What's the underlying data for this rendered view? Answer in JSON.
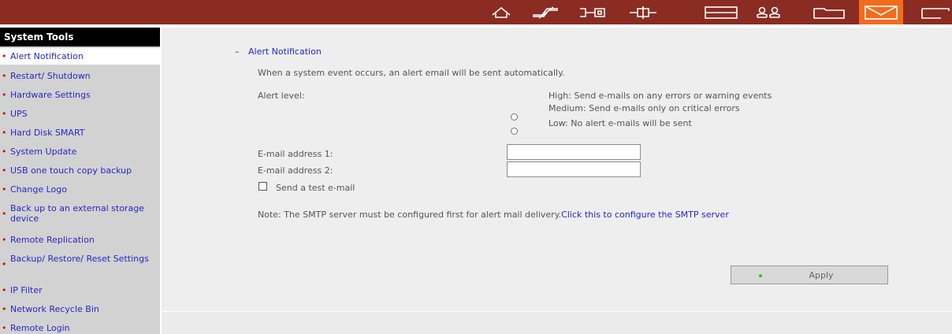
{
  "toolbar": {
    "icons": [
      {
        "name": "home-icon"
      },
      {
        "name": "network-icon"
      },
      {
        "name": "device-icon"
      },
      {
        "name": "connection-icon"
      },
      {
        "name": "disk-icon"
      },
      {
        "name": "users-icon"
      },
      {
        "name": "folder-icon"
      },
      {
        "name": "mail-icon",
        "active": true
      },
      {
        "name": "tools-icon"
      }
    ],
    "bar_color": "#8a2c22",
    "active_color": "#f26c1e"
  },
  "sidebar": {
    "header": "System Tools",
    "items": [
      {
        "label": "Alert Notification",
        "selected": true
      },
      {
        "label": "Restart/ Shutdown"
      },
      {
        "label": "Hardware Settings"
      },
      {
        "label": "UPS"
      },
      {
        "label": "Hard Disk SMART"
      },
      {
        "label": "System Update"
      },
      {
        "label": "USB one touch copy backup"
      },
      {
        "label": "Change Logo"
      },
      {
        "label": "Back up to an external storage device"
      },
      {
        "label": "Remote Replication"
      },
      {
        "label": "Backup/ Restore/ Reset Settings"
      },
      {
        "label": "IP Filter"
      },
      {
        "label": "Network Recycle Bin"
      },
      {
        "label": "Remote Login"
      }
    ]
  },
  "main": {
    "section_dash": "–",
    "section_title": "Alert Notification",
    "description": "When a system event occurs, an alert email will be sent automatically.",
    "alert_level_label": "Alert level:",
    "alert_options": [
      {
        "label": "High: Send e-mails on any errors or warning events",
        "checked": false
      },
      {
        "label": "Medium: Send e-mails only on critical errors",
        "checked": false
      },
      {
        "label": "Low: No alert e-mails will be sent",
        "checked": true
      }
    ],
    "email1_label": "E-mail address 1:",
    "email1_value": "",
    "email2_label": "E-mail address 2:",
    "email2_value": "",
    "test_email_label": "Send a test e-mail",
    "test_email_checked": false,
    "note_text": "Note: The SMTP server must be configured first for alert mail delivery.",
    "note_link": "Click this to configure the SMTP server",
    "apply_label": "Apply"
  }
}
